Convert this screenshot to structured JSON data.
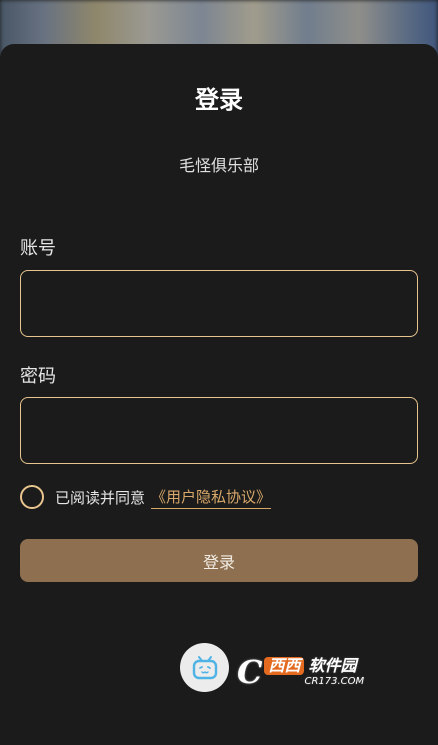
{
  "header": {
    "title": "登录",
    "subtitle": "毛怪俱乐部"
  },
  "form": {
    "account_label": "账号",
    "account_value": "",
    "password_label": "密码",
    "password_value": "",
    "agree_text": "已阅读并同意",
    "agree_link": "《用户隐私协议》",
    "agree_checked": false,
    "login_label": "登录"
  },
  "footer": {
    "logo_icon": "bilibili-tv-icon"
  },
  "watermark": {
    "c": "C",
    "xixi": "西西",
    "soft": "软件园",
    "url": "CR173.COM"
  },
  "colors": {
    "background": "#1b1b1b",
    "accent_border": "#e8c58e",
    "link": "#d8a86a",
    "button": "#8e7050",
    "logo": "#4fb3e6"
  }
}
